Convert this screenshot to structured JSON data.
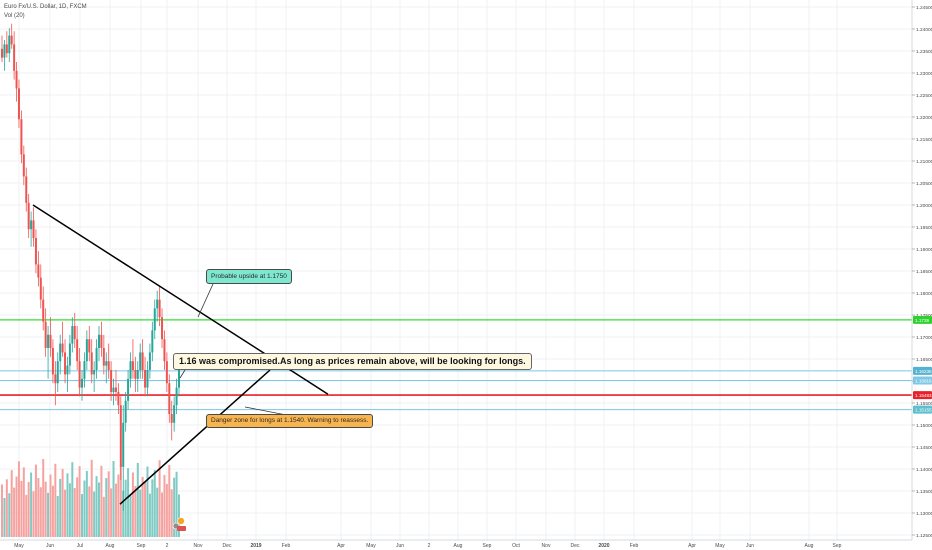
{
  "legend": {
    "symbol_line": "Euro Fx/U.S. Dollar, 1D, FXCM",
    "volume_line": "Vol (20)"
  },
  "annotations": {
    "upside": "Probable upside at 1.1750",
    "main": "1.16 was compromised.As long as prices remain above, will be looking for longs.",
    "danger": "Danger zone for longs at 1.1540. Warning to reassess."
  },
  "colors": {
    "background": "#ffffff",
    "grid": "#eef1f6",
    "up_candle": "#26a69a",
    "down_candle": "#ef5350",
    "up_volume": "#7fcbc4",
    "down_volume": "#f5a3a1",
    "resistance_line": "#33dd33",
    "support_line": "#e8202a",
    "level_line": "#7ec8e3",
    "trendline": "#000000",
    "axis_text": "#4a4a4a"
  },
  "chart_data": {
    "type": "candlestick",
    "title": "",
    "ylim": [
      1.125,
      1.245
    ],
    "y_ticks": [
      1.245,
      1.24,
      1.235,
      1.23,
      1.225,
      1.22,
      1.215,
      1.21,
      1.205,
      1.2,
      1.195,
      1.19,
      1.185,
      1.18,
      1.175,
      1.17,
      1.165,
      1.16,
      1.155,
      1.15,
      1.145,
      1.14,
      1.135,
      1.13,
      1.125
    ],
    "y_tick_labels": [
      "1.24500",
      "1.24000",
      "1.23500",
      "1.23000",
      "1.22500",
      "1.22000",
      "1.21500",
      "1.21000",
      "1.20500",
      "1.20000",
      "1.19500",
      "1.19000",
      "1.18500",
      "1.18000",
      "1.17500",
      "1.17000",
      "1.16500",
      "1.16000",
      "1.15500",
      "1.15000",
      "1.14500",
      "1.14000",
      "1.13500",
      "1.13000",
      "1.12500"
    ],
    "x_ticks": [
      "May",
      "Jun",
      "Jul",
      "Aug",
      "Sep",
      "2",
      "Nov",
      "Dec",
      "2019",
      "Feb",
      "Apr",
      "May",
      "Jun",
      "2",
      "Aug",
      "Sep",
      "Oct",
      "Nov",
      "Dec",
      "2020",
      "Feb",
      "Apr",
      "May",
      "Jun",
      "Aug",
      "Sep"
    ],
    "price_levels": [
      {
        "name": "resistance",
        "value": 1.1739,
        "label": "1.1739"
      },
      {
        "name": "current-price",
        "value": 1.1623,
        "label": "1.16236"
      },
      {
        "name": "level-high",
        "value": 1.1601,
        "label": "1.15816"
      },
      {
        "name": "support",
        "value": 1.1568,
        "label": "1.15483"
      },
      {
        "name": "level-low",
        "value": 1.1535,
        "label": "1.15155"
      }
    ],
    "trendlines": [
      {
        "name": "descending-trendline",
        "from": {
          "x": "Apr",
          "y": 1.2
        },
        "to": {
          "x": "2019",
          "y": 1.157
        }
      },
      {
        "name": "ascending-trendline",
        "from": {
          "x": "Aug",
          "y": 1.132
        },
        "to": {
          "x": "Oct",
          "y": 1.1625
        }
      }
    ],
    "candles": [
      {
        "o": 1.2355,
        "h": 1.2385,
        "l": 1.2325,
        "c": 1.2335
      },
      {
        "o": 1.2335,
        "h": 1.2375,
        "l": 1.2305,
        "c": 1.2365
      },
      {
        "o": 1.2365,
        "h": 1.2395,
        "l": 1.2335,
        "c": 1.2345
      },
      {
        "o": 1.2345,
        "h": 1.2402,
        "l": 1.2325,
        "c": 1.2385
      },
      {
        "o": 1.2385,
        "h": 1.2412,
        "l": 1.2355,
        "c": 1.2365
      },
      {
        "o": 1.2365,
        "h": 1.2395,
        "l": 1.2285,
        "c": 1.2305
      },
      {
        "o": 1.2305,
        "h": 1.2325,
        "l": 1.2235,
        "c": 1.2265
      },
      {
        "o": 1.2265,
        "h": 1.2285,
        "l": 1.2175,
        "c": 1.2195
      },
      {
        "o": 1.2195,
        "h": 1.2215,
        "l": 1.2095,
        "c": 1.2115
      },
      {
        "o": 1.2115,
        "h": 1.2135,
        "l": 1.2045,
        "c": 1.2065
      },
      {
        "o": 1.2065,
        "h": 1.2085,
        "l": 1.1985,
        "c": 1.2005
      },
      {
        "o": 1.2005,
        "h": 1.2025,
        "l": 1.1925,
        "c": 1.1945
      },
      {
        "o": 1.1945,
        "h": 1.1985,
        "l": 1.1905,
        "c": 1.1965
      },
      {
        "o": 1.1965,
        "h": 1.1995,
        "l": 1.1905,
        "c": 1.1925
      },
      {
        "o": 1.1925,
        "h": 1.1945,
        "l": 1.1845,
        "c": 1.1865
      },
      {
        "o": 1.1865,
        "h": 1.1895,
        "l": 1.1815,
        "c": 1.1835
      },
      {
        "o": 1.1835,
        "h": 1.1865,
        "l": 1.1765,
        "c": 1.1785
      },
      {
        "o": 1.1785,
        "h": 1.1815,
        "l": 1.1715,
        "c": 1.1735
      },
      {
        "o": 1.1735,
        "h": 1.1765,
        "l": 1.1655,
        "c": 1.1675
      },
      {
        "o": 1.1675,
        "h": 1.1725,
        "l": 1.1605,
        "c": 1.1705
      },
      {
        "o": 1.1705,
        "h": 1.1745,
        "l": 1.1655,
        "c": 1.1675
      },
      {
        "o": 1.1675,
        "h": 1.1695,
        "l": 1.1595,
        "c": 1.1615
      },
      {
        "o": 1.1615,
        "h": 1.1645,
        "l": 1.1545,
        "c": 1.1595
      },
      {
        "o": 1.1595,
        "h": 1.1665,
        "l": 1.1575,
        "c": 1.1645
      },
      {
        "o": 1.1645,
        "h": 1.1705,
        "l": 1.1615,
        "c": 1.1685
      },
      {
        "o": 1.1685,
        "h": 1.1735,
        "l": 1.1655,
        "c": 1.1665
      },
      {
        "o": 1.1665,
        "h": 1.1695,
        "l": 1.1595,
        "c": 1.1615
      },
      {
        "o": 1.1615,
        "h": 1.1655,
        "l": 1.1575,
        "c": 1.1635
      },
      {
        "o": 1.1635,
        "h": 1.1705,
        "l": 1.1615,
        "c": 1.1685
      },
      {
        "o": 1.1685,
        "h": 1.1745,
        "l": 1.1665,
        "c": 1.1725
      },
      {
        "o": 1.1725,
        "h": 1.1755,
        "l": 1.1675,
        "c": 1.1695
      },
      {
        "o": 1.1695,
        "h": 1.1725,
        "l": 1.1625,
        "c": 1.1645
      },
      {
        "o": 1.1645,
        "h": 1.1675,
        "l": 1.1565,
        "c": 1.1585
      },
      {
        "o": 1.1585,
        "h": 1.1625,
        "l": 1.1555,
        "c": 1.1605
      },
      {
        "o": 1.1605,
        "h": 1.1665,
        "l": 1.1585,
        "c": 1.1645
      },
      {
        "o": 1.1645,
        "h": 1.1715,
        "l": 1.1625,
        "c": 1.1695
      },
      {
        "o": 1.1695,
        "h": 1.1725,
        "l": 1.1645,
        "c": 1.1665
      },
      {
        "o": 1.1665,
        "h": 1.1695,
        "l": 1.1595,
        "c": 1.1615
      },
      {
        "o": 1.1615,
        "h": 1.1645,
        "l": 1.1575,
        "c": 1.1625
      },
      {
        "o": 1.1625,
        "h": 1.1695,
        "l": 1.1605,
        "c": 1.1675
      },
      {
        "o": 1.1675,
        "h": 1.1725,
        "l": 1.1645,
        "c": 1.1705
      },
      {
        "o": 1.1705,
        "h": 1.1735,
        "l": 1.1655,
        "c": 1.1675
      },
      {
        "o": 1.1675,
        "h": 1.1705,
        "l": 1.1615,
        "c": 1.1635
      },
      {
        "o": 1.1635,
        "h": 1.1665,
        "l": 1.1595,
        "c": 1.1645
      },
      {
        "o": 1.1645,
        "h": 1.1685,
        "l": 1.1605,
        "c": 1.1625
      },
      {
        "o": 1.1625,
        "h": 1.1645,
        "l": 1.1555,
        "c": 1.1575
      },
      {
        "o": 1.1575,
        "h": 1.1605,
        "l": 1.1545,
        "c": 1.1585
      },
      {
        "o": 1.1585,
        "h": 1.1625,
        "l": 1.1555,
        "c": 1.1575
      },
      {
        "o": 1.1575,
        "h": 1.1595,
        "l": 1.1525,
        "c": 1.1545
      },
      {
        "o": 1.1545,
        "h": 1.1565,
        "l": 1.1375,
        "c": 1.1405
      },
      {
        "o": 1.1405,
        "h": 1.1545,
        "l": 1.1305,
        "c": 1.1505
      },
      {
        "o": 1.1505,
        "h": 1.1575,
        "l": 1.1485,
        "c": 1.1555
      },
      {
        "o": 1.1555,
        "h": 1.1625,
        "l": 1.1535,
        "c": 1.1605
      },
      {
        "o": 1.1605,
        "h": 1.1665,
        "l": 1.1585,
        "c": 1.1645
      },
      {
        "o": 1.1645,
        "h": 1.1695,
        "l": 1.1605,
        "c": 1.1625
      },
      {
        "o": 1.1625,
        "h": 1.1655,
        "l": 1.1575,
        "c": 1.1605
      },
      {
        "o": 1.1605,
        "h": 1.1645,
        "l": 1.1575,
        "c": 1.1625
      },
      {
        "o": 1.1625,
        "h": 1.1685,
        "l": 1.1605,
        "c": 1.1665
      },
      {
        "o": 1.1665,
        "h": 1.1695,
        "l": 1.1605,
        "c": 1.1625
      },
      {
        "o": 1.1625,
        "h": 1.1655,
        "l": 1.1565,
        "c": 1.1585
      },
      {
        "o": 1.1585,
        "h": 1.1645,
        "l": 1.1565,
        "c": 1.1625
      },
      {
        "o": 1.1625,
        "h": 1.1685,
        "l": 1.1605,
        "c": 1.1665
      },
      {
        "o": 1.1665,
        "h": 1.1735,
        "l": 1.1645,
        "c": 1.1715
      },
      {
        "o": 1.1715,
        "h": 1.1785,
        "l": 1.1695,
        "c": 1.1765
      },
      {
        "o": 1.1765,
        "h": 1.1805,
        "l": 1.1735,
        "c": 1.1785
      },
      {
        "o": 1.1785,
        "h": 1.1815,
        "l": 1.1725,
        "c": 1.1745
      },
      {
        "o": 1.1745,
        "h": 1.1765,
        "l": 1.1675,
        "c": 1.1695
      },
      {
        "o": 1.1695,
        "h": 1.1715,
        "l": 1.1625,
        "c": 1.1645
      },
      {
        "o": 1.1645,
        "h": 1.1665,
        "l": 1.1575,
        "c": 1.1595
      },
      {
        "o": 1.1595,
        "h": 1.1615,
        "l": 1.1505,
        "c": 1.1525
      },
      {
        "o": 1.1525,
        "h": 1.1555,
        "l": 1.1465,
        "c": 1.1505
      },
      {
        "o": 1.1505,
        "h": 1.1565,
        "l": 1.1485,
        "c": 1.1545
      },
      {
        "o": 1.1545,
        "h": 1.1605,
        "l": 1.1525,
        "c": 1.1585
      },
      {
        "o": 1.1585,
        "h": 1.1645,
        "l": 1.1565,
        "c": 1.1625
      }
    ],
    "volume": [
      1320,
      980,
      1450,
      1100,
      1680,
      1240,
      1520,
      1900,
      1410,
      1750,
      1060,
      1380,
      1620,
      1150,
      1820,
      1480,
      1250,
      1960,
      1390,
      1110,
      1570,
      1290,
      1840,
      1030,
      1460,
      1710,
      1190,
      1600,
      1350,
      1880,
      1230,
      1500,
      1780,
      1080,
      1420,
      1660,
      1270,
      1940,
      1140,
      1530,
      1370,
      1790,
      1010,
      1480,
      1650,
      1220,
      1910,
      1340,
      1570,
      1820,
      1160,
      1440,
      1730,
      1050,
      1620,
      1280,
      1860,
      1190,
      1510,
      1390,
      1770,
      1090,
      1450,
      1680,
      1240,
      1930,
      1120,
      1560,
      1330,
      1810,
      1200,
      1490,
      1640,
      1070
    ]
  }
}
